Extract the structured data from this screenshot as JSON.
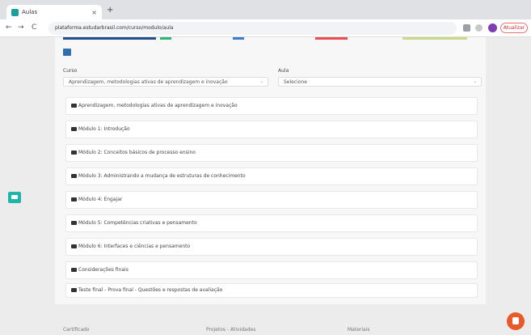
{
  "browser": {
    "tab_title": "Aulas",
    "tab_close": "×",
    "new_tab": "+",
    "back": "←",
    "forward": "→",
    "reload": "C",
    "url": "plataforma.estudarbrasil.com/curso/modulo/aula",
    "update_label": "Atualizar"
  },
  "page": {
    "course_label": "Curso",
    "course_value": "Aprendizagem, metodologias ativas de aprendizagem e inovação",
    "lesson_label": "Aula",
    "lesson_value": "Selecione",
    "caret": "⌄",
    "items": [
      "Aprendizagem, metodologias ativas de aprendizagem e inovação",
      "Módulo 1: Introdução",
      "Módulo 2: Conceitos básicos de processo ensino",
      "Módulo 3: Administrando a mudança de estruturas de conhecimento",
      "Módulo 4: Engajar",
      "Módulo 5: Competências criativas e pensamento",
      "Módulo 6: Interfaces e ciências e pensamento",
      "Considerações finais",
      "Teste final - Prova final - Questões e respostas de avaliação"
    ],
    "footer": [
      "Certificado",
      "Projetos - Atividades",
      "Materiais"
    ]
  }
}
